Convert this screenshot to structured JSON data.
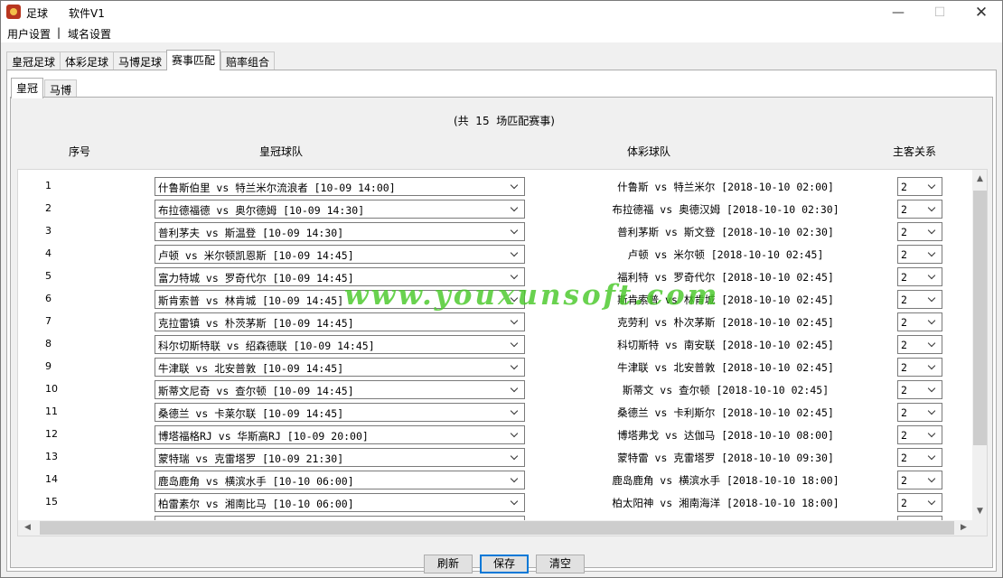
{
  "titlebar": {
    "app_name": "足球",
    "app_version": "软件V1"
  },
  "menu": {
    "items": [
      "用户设置",
      "|",
      "域名设置"
    ]
  },
  "tabs": [
    "皇冠足球",
    "体彩足球",
    "马博足球",
    "赛事匹配",
    "赔率组合"
  ],
  "active_tab": "赛事匹配",
  "subtabs": [
    "皇冠",
    "马博"
  ],
  "active_subtab": "皇冠",
  "summary": "(共  15  场匹配赛事)",
  "columns": {
    "index": "序号",
    "crown": "皇冠球队",
    "lottery": "体彩球队",
    "relation": "主客关系"
  },
  "rows": [
    {
      "idx": "1",
      "crown": "什鲁斯伯里 vs 特兰米尔流浪者 [10-09 14:00]",
      "lottery": "什鲁斯 vs 特兰米尔 [2018-10-10 02:00]",
      "relation": "2"
    },
    {
      "idx": "2",
      "crown": "布拉德福德 vs 奥尔德姆 [10-09 14:30]",
      "lottery": "布拉德福 vs 奥德汉姆 [2018-10-10 02:30]",
      "relation": "2"
    },
    {
      "idx": "3",
      "crown": "普利茅夫 vs 斯温登 [10-09 14:30]",
      "lottery": "普利茅斯 vs 斯文登 [2018-10-10 02:30]",
      "relation": "2"
    },
    {
      "idx": "4",
      "crown": "卢顿 vs 米尔顿凯恩斯 [10-09 14:45]",
      "lottery": "卢顿 vs 米尔顿 [2018-10-10 02:45]",
      "relation": "2"
    },
    {
      "idx": "5",
      "crown": "富力特城 vs 罗奇代尔 [10-09 14:45]",
      "lottery": "福利特 vs 罗奇代尔 [2018-10-10 02:45]",
      "relation": "2"
    },
    {
      "idx": "6",
      "crown": "斯肯索普 vs 林肯城 [10-09 14:45]",
      "lottery": "斯肯索普 vs 林肯城 [2018-10-10 02:45]",
      "relation": "2"
    },
    {
      "idx": "7",
      "crown": "克拉雷镇 vs 朴茨茅斯 [10-09 14:45]",
      "lottery": "克劳利 vs 朴次茅斯 [2018-10-10 02:45]",
      "relation": "2"
    },
    {
      "idx": "8",
      "crown": "科尔切斯特联 vs 绍森德联 [10-09 14:45]",
      "lottery": "科切斯特 vs 南安联 [2018-10-10 02:45]",
      "relation": "2"
    },
    {
      "idx": "9",
      "crown": "牛津联 vs 北安普敦 [10-09 14:45]",
      "lottery": "牛津联 vs 北安普敦 [2018-10-10 02:45]",
      "relation": "2"
    },
    {
      "idx": "10",
      "crown": "斯蒂文尼奇 vs 查尔顿 [10-09 14:45]",
      "lottery": "斯蒂文 vs 查尔顿 [2018-10-10 02:45]",
      "relation": "2"
    },
    {
      "idx": "11",
      "crown": "桑德兰 vs 卡莱尔联 [10-09 14:45]",
      "lottery": "桑德兰 vs 卡利斯尔 [2018-10-10 02:45]",
      "relation": "2"
    },
    {
      "idx": "12",
      "crown": "博塔福格RJ vs 华斯高RJ [10-09 20:00]",
      "lottery": "博塔弗戈 vs 达伽马 [2018-10-10 08:00]",
      "relation": "2"
    },
    {
      "idx": "13",
      "crown": "蒙特瑞 vs 克雷塔罗 [10-09 21:30]",
      "lottery": "蒙特雷 vs 克雷塔罗 [2018-10-10 09:30]",
      "relation": "2"
    },
    {
      "idx": "14",
      "crown": "鹿岛鹿角 vs 横滨水手 [10-10 06:00]",
      "lottery": "鹿岛鹿角 vs 横滨水手 [2018-10-10 18:00]",
      "relation": "2"
    },
    {
      "idx": "15",
      "crown": "柏雷素尔 vs 湘南比马 [10-10 06:00]",
      "lottery": "柏太阳神 vs 湘南海洋 [2018-10-10 18:00]",
      "relation": "2"
    }
  ],
  "buttons": {
    "refresh": "刷新",
    "save": "保存",
    "clear": "清空"
  },
  "watermark": "www.youxunsoft.com",
  "icons": {
    "app": "football-app-icon",
    "dropdown": "chevron-down-icon"
  }
}
